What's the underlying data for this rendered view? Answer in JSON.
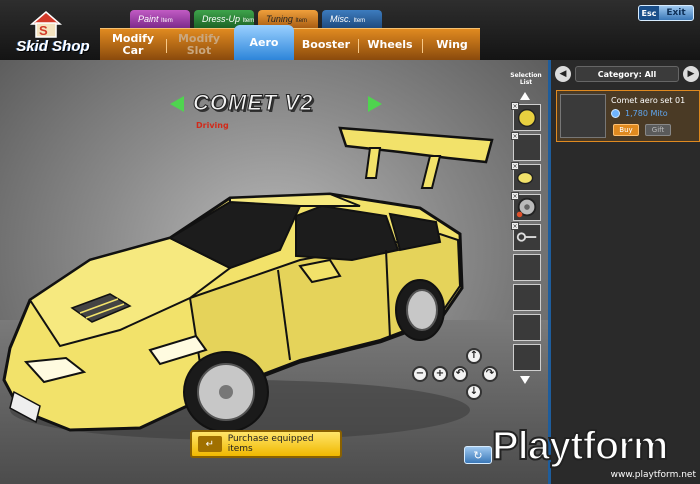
{
  "logo": {
    "text": "Skid Shop"
  },
  "category_tabs": [
    {
      "label": "Paint",
      "suffix": "Item"
    },
    {
      "label": "Dress-Up",
      "suffix": "Item"
    },
    {
      "label": "Tuning",
      "suffix": "Item"
    },
    {
      "label": "Misc.",
      "suffix": "Item"
    }
  ],
  "sub_tabs": {
    "modify_car": "Modify\nCar",
    "modify_slot": "Modify\nSlot",
    "aero": "Aero",
    "booster": "Booster",
    "wheels": "Wheels",
    "wing": "Wing"
  },
  "window": {
    "esc": "Esc",
    "exit": "Exit"
  },
  "car": {
    "name": "COMET V2",
    "state": "Driving",
    "color": "#f2e26a"
  },
  "selection_list": {
    "title": "Selection List",
    "slot_count": 10
  },
  "purchase": {
    "label": "Purchase equipped items",
    "icon": "return-arrow-icon"
  },
  "panel": {
    "category": "Category: All",
    "items": [
      {
        "name": "Comet aero set 01",
        "price": "1,780 Mito",
        "buy": "Buy",
        "gift": "Gift"
      }
    ]
  },
  "watermark": {
    "text": "Playtform",
    "url": "www.playtform.net"
  },
  "colors": {
    "accent_orange": "#e08a20",
    "accent_blue": "#2a83d8",
    "price_blue": "#5fa6f0"
  }
}
